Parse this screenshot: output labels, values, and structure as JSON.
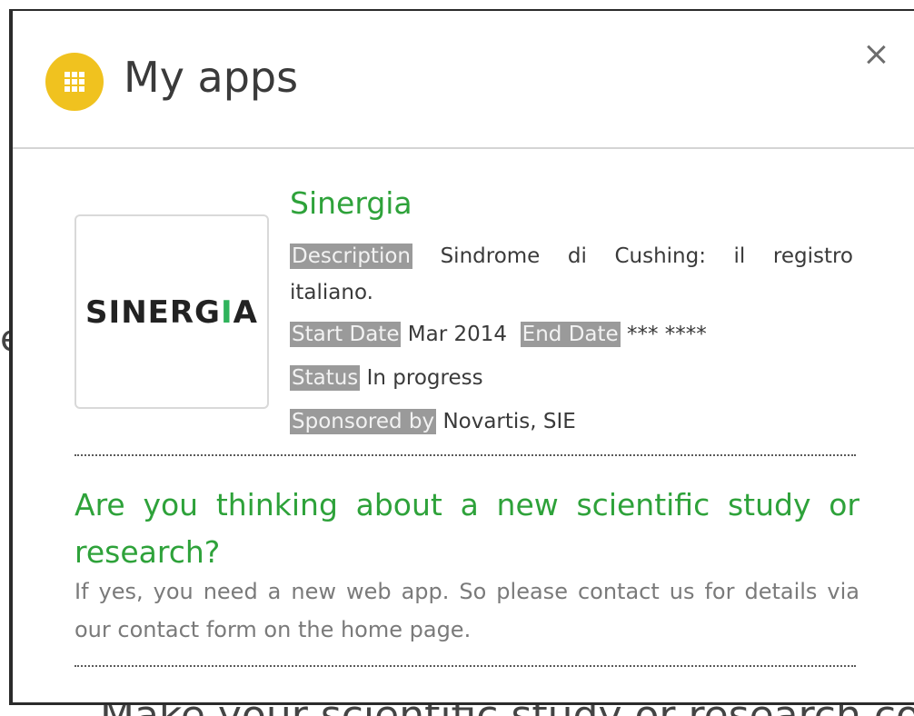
{
  "modal": {
    "title": "My apps",
    "close_icon": "close-icon",
    "header_icon": "apps-grid-icon",
    "header_icon_color": "#f0c21f"
  },
  "app": {
    "name": "Sinergia",
    "logo_text_parts": [
      "S",
      "INERG",
      "I",
      "A"
    ],
    "description_label": "Description",
    "description_line1": "Sindrome di Cushing: il registro",
    "description_line2": "italiano.",
    "start_label": "Start Date",
    "start_value": "Mar 2014",
    "end_label": "End Date",
    "end_value": "*** ****",
    "status_label": "Status",
    "status_value": "In progress",
    "sponsor_label": "Sponsored by",
    "sponsor_value": "Novartis, SIE"
  },
  "cta": {
    "title": "Are you thinking about a new scientific study or research?",
    "body": "If yes, you need a new web app. So please contact us for details via our contact form on the home page."
  },
  "background": {
    "partial_text": "Make your scientific study or research com",
    "partial_glyph": "e"
  },
  "colors": {
    "accent_green": "#2ea23a",
    "label_bg": "#9a9a9a"
  }
}
